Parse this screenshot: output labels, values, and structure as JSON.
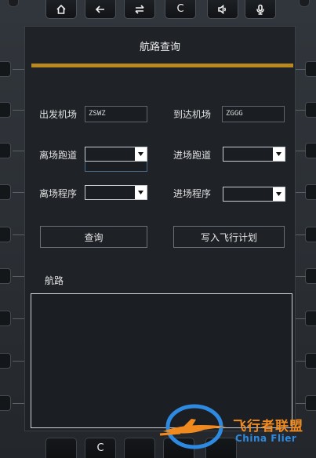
{
  "toolbar": {
    "home_icon": "home-icon",
    "back_icon": "back-arrow-icon",
    "swap_icon": "swap-icon",
    "clear_label": "C",
    "sound_icon": "speaker-icon",
    "mic_icon": "microphone-icon"
  },
  "panel": {
    "title": "航路查询"
  },
  "form": {
    "departure_label": "出发机场",
    "departure_value": "ZSWZ",
    "arrival_label": "到达机场",
    "arrival_value": "ZGGG",
    "dep_runway_label": "离场跑道",
    "arr_runway_label": "进场跑道",
    "sid_label": "离场程序",
    "star_label": "进场程序"
  },
  "actions": {
    "query_label": "查询",
    "write_plan_label": "写入飞行计划"
  },
  "route": {
    "label": "航路"
  },
  "bottom": {
    "clear_label": "C"
  },
  "watermark": {
    "text": "飞行者联盟",
    "sub": "China Flier"
  },
  "colors": {
    "accent_gold": "#b8891e",
    "panel_bg": "#1f2328",
    "watermark_orange": "#f08a1e",
    "watermark_blue": "#2d8ae0"
  }
}
